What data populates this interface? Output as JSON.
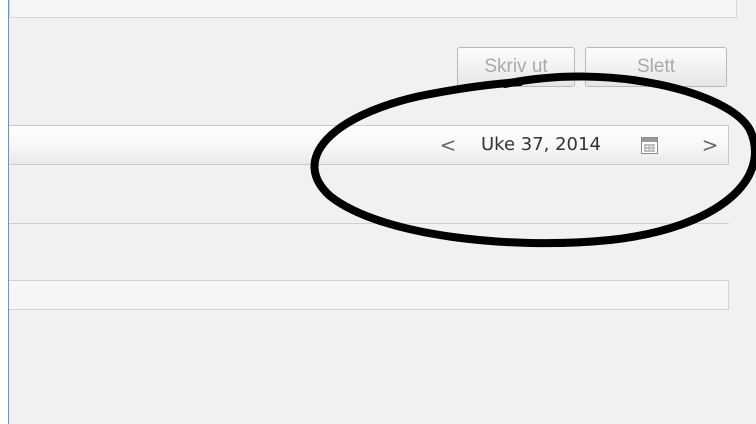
{
  "toolbar": {
    "print_label": "Skriv ut",
    "delete_label": "Slett"
  },
  "week_nav": {
    "label": "Uke 37, 2014",
    "prev_icon": "chevron-left-icon",
    "next_icon": "chevron-right-icon",
    "calendar_icon": "calendar-icon",
    "prev_glyph": "<",
    "next_glyph": ">"
  },
  "colors": {
    "panel_background": "#f1f1f1",
    "panel_left_border": "#5b9bd5",
    "button_text_disabled": "#a9a9a9",
    "annotation_ink": "#000000"
  }
}
